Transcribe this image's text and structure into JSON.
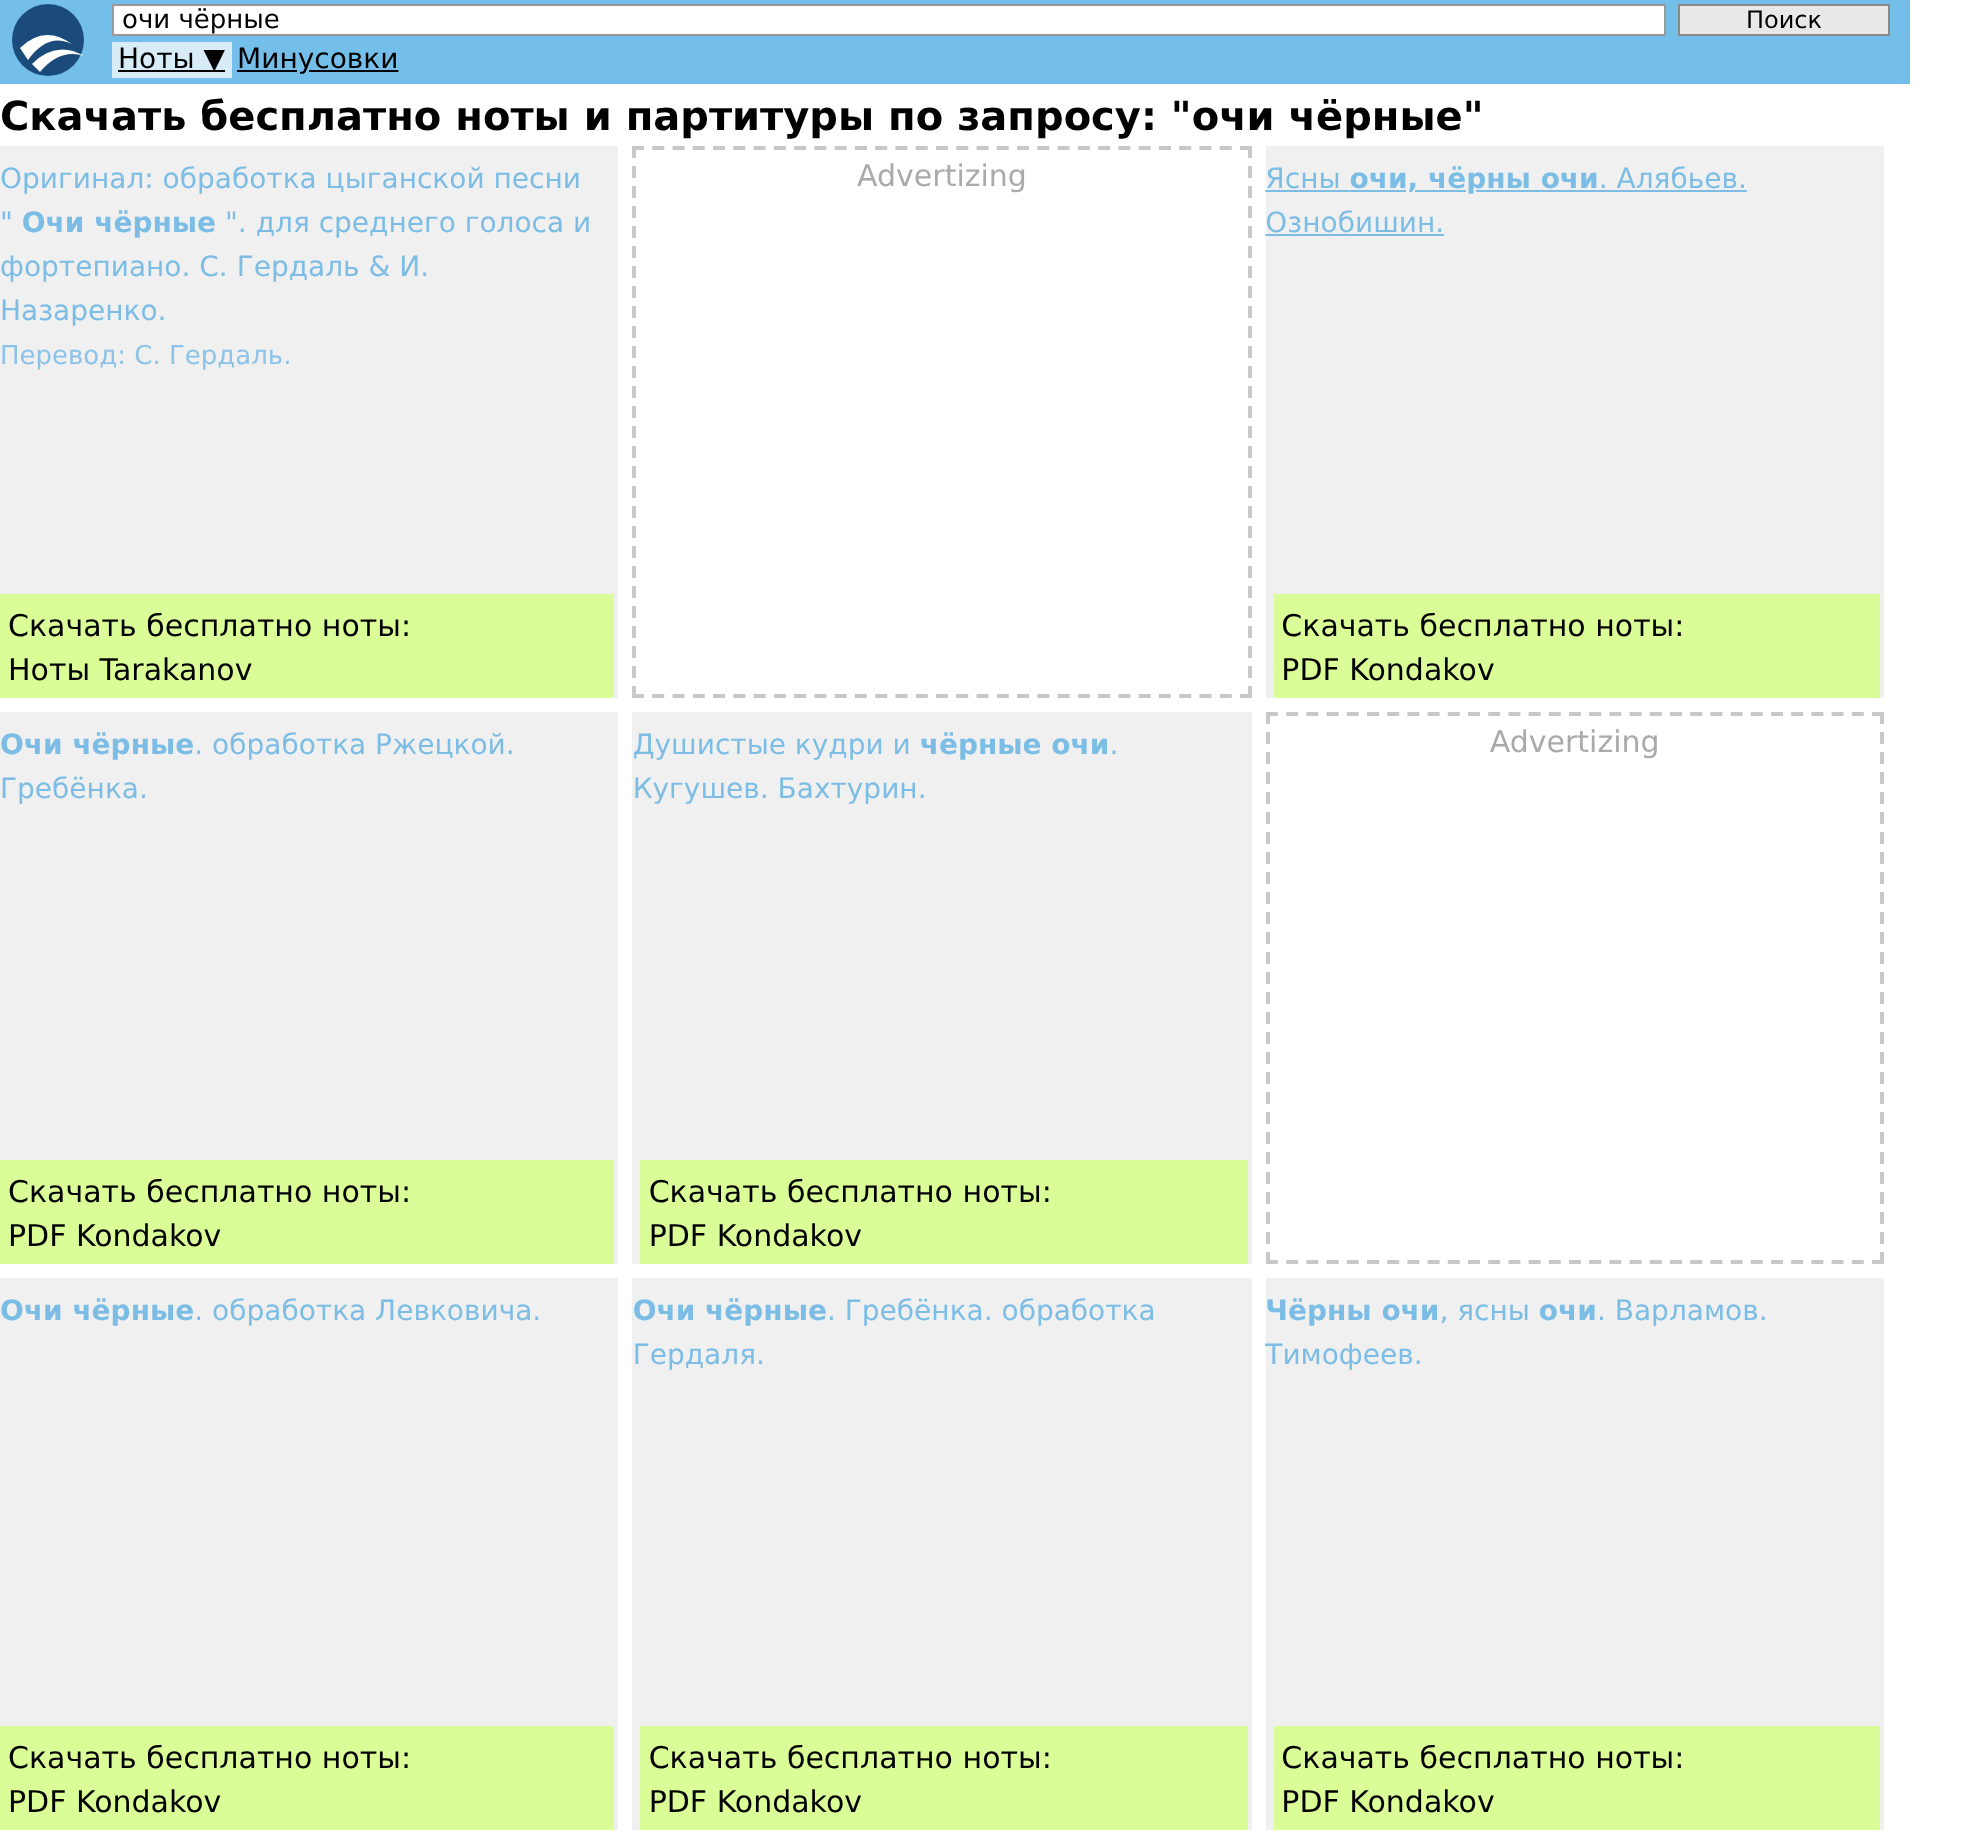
{
  "header": {
    "search_value": "очи чёрные",
    "search_button": "Поиск",
    "nav": [
      {
        "label": "Ноты ▼",
        "selected": true
      },
      {
        "label": "Минусовки",
        "selected": false
      }
    ]
  },
  "heading": "Скачать бесплатно ноты и партитуры по запросу: \"очи чёрные\"",
  "cards": [
    {
      "kind": "result",
      "title": "Оригинал: обработка цыганской песни \" **Очи чёрные** \". для среднего голоса и фортепиано. С. Гердаль & И. Назаренко.",
      "note": "Перевод: С. Гердаль.",
      "hovered": false,
      "download_label": "Скачать бесплатно ноты:",
      "source": "Ноты Tarakanov"
    },
    {
      "kind": "ad",
      "label": "Advertizing"
    },
    {
      "kind": "result",
      "title": "Ясны **очи, чёрны очи**. Алябьев. Ознобишин. ",
      "hovered": true,
      "download_label": "Скачать бесплатно ноты:",
      "source": "PDF Kondakov"
    },
    {
      "kind": "result",
      "title": "**Очи чёрные**. обработка Ржецкой. Гребёнка.",
      "hovered": false,
      "download_label": "Скачать бесплатно ноты:",
      "source": "PDF Kondakov"
    },
    {
      "kind": "result",
      "title": "Душистые кудри и **чёрные очи**. Кугушев. Бахтурин.",
      "hovered": false,
      "download_label": "Скачать бесплатно ноты:",
      "source": "PDF Kondakov"
    },
    {
      "kind": "ad",
      "label": "Advertizing"
    },
    {
      "kind": "result",
      "title": "**Очи чёрные**. обработка Левковича.",
      "hovered": false,
      "download_label": "Скачать бесплатно ноты:",
      "source": "PDF Kondakov"
    },
    {
      "kind": "result",
      "title": "**Очи чёрные**. Гребёнка. обработка Гердаля.",
      "hovered": false,
      "download_label": "Скачать бесплатно ноты:",
      "source": "PDF Kondakov"
    },
    {
      "kind": "result",
      "title": "**Чёрны очи**, ясны **очи**. Варламов. Тимофеев.",
      "hovered": false,
      "download_label": "Скачать бесплатно ноты:",
      "source": "PDF Kondakov"
    }
  ]
}
